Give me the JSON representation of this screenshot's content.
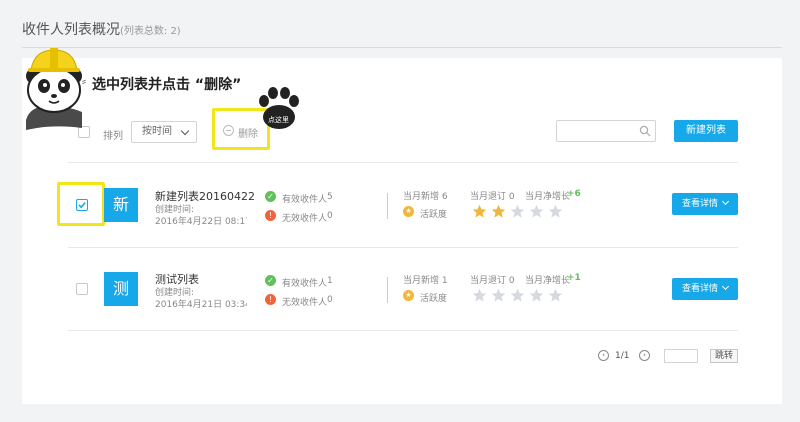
{
  "page": {
    "title": "收件人列表概况",
    "subtitle": "(列表总数: 2)"
  },
  "tip": {
    "text": "选中列表并点击 “删除”"
  },
  "toolbar": {
    "sort_label": "排列",
    "sort_value": "按时间",
    "delete_label": "删除",
    "paw_label": "点这里",
    "search_placeholder": "",
    "new_list_label": "新建列表"
  },
  "lists": [
    {
      "checked": true,
      "avatar": "新",
      "name": "新建列表20160422",
      "created_label": "创建时间:",
      "created_time": "2016年4月22日 08:17 Fric",
      "valid_label": "有效收件人",
      "valid_count": "5",
      "invalid_label": "无效收件人",
      "invalid_count": "0",
      "new_this_month": "当月新增 6",
      "unsub_this_month": "当月退订 0",
      "net_growth_label": "当月净增长",
      "net_growth_value": "+6",
      "activity_label": "活跃度",
      "activity_rating": 2,
      "detail_label": "查看详情"
    },
    {
      "checked": false,
      "avatar": "测",
      "name": "测试列表",
      "created_label": "创建时间:",
      "created_time": "2016年4月21日 03:34 Thu",
      "valid_label": "有效收件人",
      "valid_count": "1",
      "invalid_label": "无效收件人",
      "invalid_count": "0",
      "new_this_month": "当月新增 1",
      "unsub_this_month": "当月退订 0",
      "net_growth_label": "当月净增长",
      "net_growth_value": "+1",
      "activity_label": "活跃度",
      "activity_rating": 0,
      "detail_label": "查看详情"
    }
  ],
  "pager": {
    "prev_icon": "‹",
    "page_info": "1/1",
    "next_icon": "›",
    "jump_label": "跳转"
  },
  "colors": {
    "accent": "#16a8e8",
    "highlight": "#f2e61a",
    "star_on": "#f2b63a",
    "star_off": "#d6d9de",
    "green": "#62c05c",
    "red": "#f0643c"
  }
}
